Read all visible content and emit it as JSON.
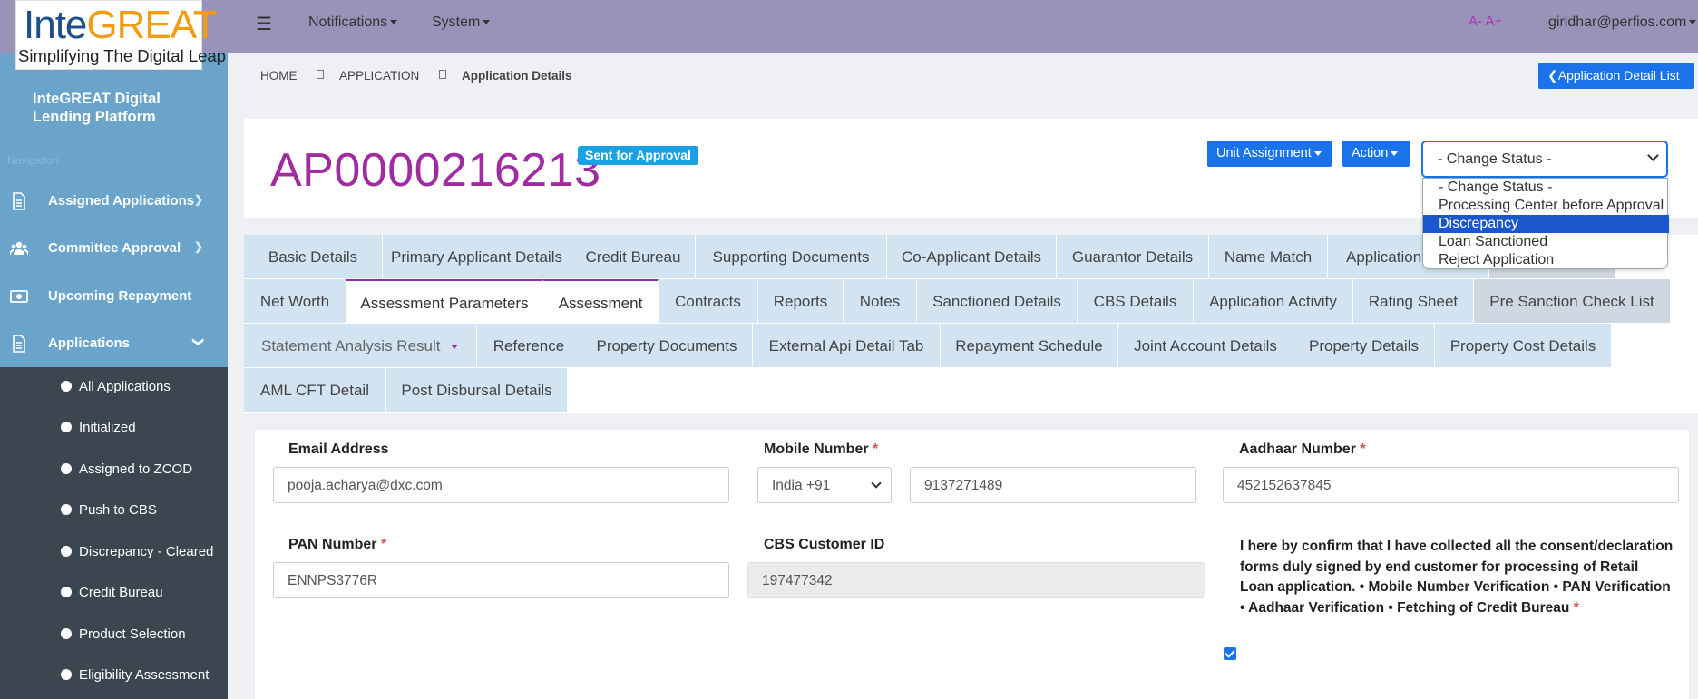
{
  "brand": {
    "logo_prefix": "Inte",
    "logo_suffix": "GREAT",
    "tagline": "Simplifying The Digital Leap",
    "platform_name": "InteGREAT Digital Lending Platform"
  },
  "topbar": {
    "notifications": "Notifications",
    "system": "System",
    "font_size": "A- A+",
    "user_email": "giridhar@perfios.com"
  },
  "sidebar": {
    "section_label": "Navigation",
    "items": [
      {
        "label": "Assigned Applications",
        "icon": "document-icon"
      },
      {
        "label": "Committee Approval",
        "icon": "users-icon"
      },
      {
        "label": "Upcoming Repayment",
        "icon": "money-icon"
      },
      {
        "label": "Applications",
        "icon": "document-icon"
      }
    ],
    "submenu": [
      "All Applications",
      "Initialized",
      "Assigned to ZCOD",
      "Push to CBS",
      "Discrepancy - Cleared",
      "Credit Bureau",
      "Product Selection",
      "Eligibility Assessment"
    ]
  },
  "breadcrumb": {
    "home": "HOME",
    "application": "APPLICATION",
    "current": "Application Details"
  },
  "header": {
    "detail_list_button": "Application Detail List",
    "app_id": "AP0000216213",
    "status_badge": "Sent for Approval",
    "unit_assignment": "Unit Assignment",
    "action": "Action",
    "change_status_selected": "- Change Status -",
    "change_status_options": [
      "- Change Status -",
      "Processing Center before Approval",
      "Discrepancy",
      "Loan Sanctioned",
      "Reject Application"
    ],
    "highlighted_option": "Discrepancy"
  },
  "tabs": {
    "row1": [
      "Basic Details",
      "Primary Applicant Details",
      "Credit Bureau",
      "Supporting Documents",
      "Co-Applicant Details",
      "Guarantor Details",
      "Name Match",
      "Application"
    ],
    "row2": [
      "Net Worth",
      "Assessment Parameters",
      "Assessment",
      "Contracts",
      "Reports",
      "Notes",
      "Sanctioned Details",
      "CBS Details",
      "Application Activity",
      "Rating Sheet",
      "Pre Sanction Check List"
    ],
    "row3": [
      "Statement Analysis Result",
      "Reference",
      "Property Documents",
      "External Api Detail Tab",
      "Repayment Schedule",
      "Joint Account Details",
      "Property Details",
      "Property Cost Details"
    ],
    "row4": [
      "AML CFT Detail",
      "Post Disbursal Details"
    ]
  },
  "form": {
    "email_label": "Email Address",
    "email_value": "pooja.acharya@dxc.com",
    "mobile_label": "Mobile Number",
    "country_code": "India +91",
    "mobile_value": "9137271489",
    "aadhaar_label": "Aadhaar Number",
    "aadhaar_value": "452152637845",
    "pan_label": "PAN Number",
    "pan_value": "ENNPS3776R",
    "cbs_label": "CBS Customer ID",
    "cbs_value": "197477342",
    "consent_text": "I here by confirm that I have collected all the consent/declaration forms duly signed by end customer for processing of Retail Loan application. • Mobile Number Verification • PAN Verification • Aadhaar Verification • Fetching of Credit Bureau",
    "consent_checked": true,
    "required_mark": "*"
  },
  "colors": {
    "topbar": "#9a93b9",
    "sidebar": "#6aa4cb",
    "submenu": "#3b4651",
    "accent": "#1a73e8",
    "app_id": "#a02ca0",
    "badge": "#18a2e3",
    "tab_bg": "#d2e3f1"
  }
}
